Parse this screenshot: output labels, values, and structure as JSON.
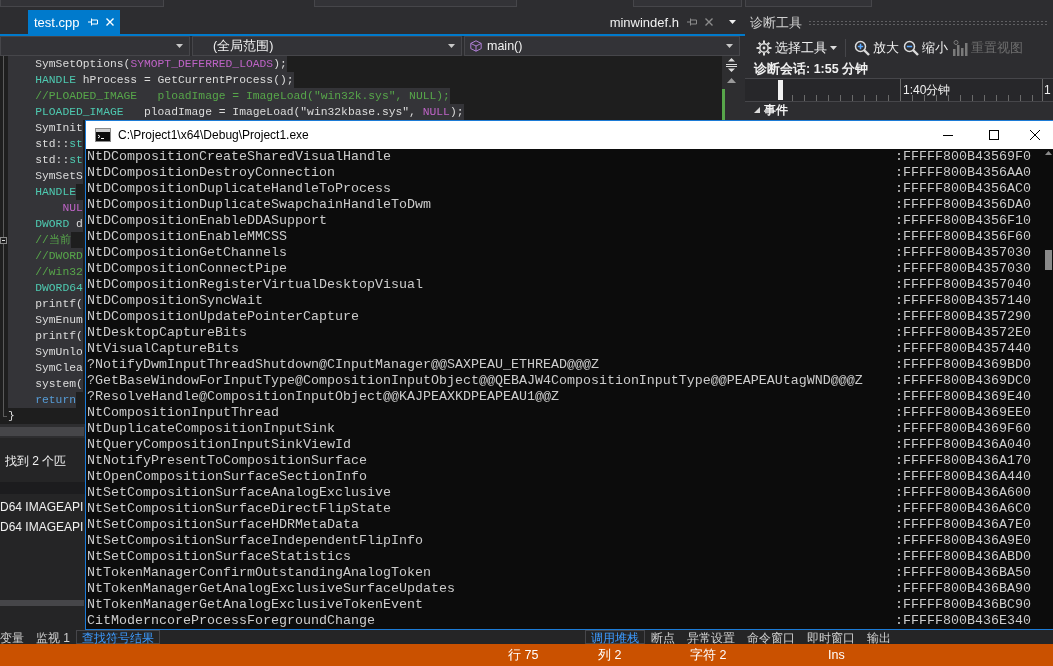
{
  "document_tabs": [
    {
      "label": "test.cpp",
      "kind": "document",
      "selected": true
    },
    {
      "label": "minwindef.h",
      "kind": "preview",
      "selected": false
    }
  ],
  "navigation_bar": {
    "scope": "(全局范围)",
    "member": "main()"
  },
  "editor": {
    "lines": [
      {
        "kind": "code",
        "selected": true,
        "tokens": [
          {
            "kind": "plain",
            "text": "    SymSetOptions("
          },
          {
            "kind": "macro",
            "text": "SYMOPT_DEFERRED_LOADS"
          },
          {
            "kind": "plain",
            "text": ");"
          }
        ]
      },
      {
        "kind": "code",
        "selected": true,
        "tokens": [
          {
            "kind": "type",
            "text": "    HANDLE"
          },
          {
            "kind": "plain",
            "text": " hProcess = GetCurrentProcess();"
          }
        ]
      },
      {
        "kind": "code",
        "selected": true,
        "tokens": [
          {
            "kind": "comment",
            "text": "    //PLOADED_IMAGE   ploadImage = ImageLoad(\"win32k.sys\", NULL);"
          }
        ]
      },
      {
        "kind": "code",
        "selected": true,
        "tokens": [
          {
            "kind": "type",
            "text": "    PLOADED_IMAGE"
          },
          {
            "kind": "plain",
            "text": "   ploadImage = ImageLoad(\"win32kbase.sys\", "
          },
          {
            "kind": "macro",
            "text": "NULL"
          },
          {
            "kind": "plain",
            "text": ");"
          }
        ]
      },
      {
        "kind": "code",
        "selected": true,
        "tokens": [
          {
            "kind": "plain",
            "text": "    SymInit"
          }
        ]
      },
      {
        "kind": "code",
        "selected": true,
        "tokens": [
          {
            "kind": "plain",
            "text": "    std::"
          },
          {
            "kind": "type",
            "text": "st"
          }
        ]
      },
      {
        "kind": "code",
        "selected": true,
        "tokens": [
          {
            "kind": "plain",
            "text": "    std::"
          },
          {
            "kind": "type",
            "text": "st"
          }
        ]
      },
      {
        "kind": "code",
        "selected": true,
        "tokens": [
          {
            "kind": "plain",
            "text": "    SymSetS"
          }
        ]
      },
      {
        "kind": "code",
        "selected": true,
        "tokens": [
          {
            "kind": "type",
            "text": "    HANDLE"
          }
        ]
      },
      {
        "kind": "code",
        "selected": true,
        "tokens": [
          {
            "kind": "macro",
            "text": "        NUL"
          }
        ]
      },
      {
        "kind": "code",
        "selected": true,
        "tokens": [
          {
            "kind": "type",
            "text": "    DWORD"
          },
          {
            "kind": "plain",
            "text": " d"
          }
        ]
      },
      {
        "kind": "fold",
        "selected": true,
        "tokens": [
          {
            "kind": "comment",
            "text": "    //当前"
          }
        ]
      },
      {
        "kind": "code",
        "selected": true,
        "tokens": [
          {
            "kind": "comment",
            "text": "    //DWORD"
          }
        ]
      },
      {
        "kind": "code",
        "selected": true,
        "tokens": [
          {
            "kind": "comment",
            "text": "    //win32"
          }
        ]
      },
      {
        "kind": "code",
        "selected": true,
        "tokens": [
          {
            "kind": "type",
            "text": "    DWORD64"
          }
        ]
      },
      {
        "kind": "code",
        "selected": true,
        "tokens": [
          {
            "kind": "plain",
            "text": "    printf("
          }
        ]
      },
      {
        "kind": "code",
        "selected": true,
        "tokens": [
          {
            "kind": "plain",
            "text": "    SymEnum"
          }
        ]
      },
      {
        "kind": "code",
        "selected": true,
        "tokens": [
          {
            "kind": "plain",
            "text": "    printf("
          }
        ]
      },
      {
        "kind": "code",
        "selected": true,
        "tokens": [
          {
            "kind": "plain",
            "text": "    SymUnlo"
          }
        ]
      },
      {
        "kind": "code",
        "selected": true,
        "tokens": [
          {
            "kind": "plain",
            "text": "    SymClea"
          }
        ]
      },
      {
        "kind": "code",
        "selected": true,
        "tokens": [
          {
            "kind": "plain",
            "text": "    system("
          }
        ]
      },
      {
        "kind": "code",
        "selected": true,
        "tokens": [
          {
            "kind": "keyword",
            "text": "    return"
          }
        ]
      },
      {
        "kind": "end",
        "selected": false,
        "tokens": [
          {
            "kind": "plain",
            "text": "}"
          }
        ]
      }
    ]
  },
  "diagnostic_tools": {
    "title": "诊断工具",
    "toolbar": [
      {
        "kind": "dropdown",
        "label": "选择工具",
        "disabled": false
      },
      {
        "kind": "button",
        "label": "放大",
        "disabled": false
      },
      {
        "kind": "button",
        "label": "缩小",
        "disabled": false
      },
      {
        "kind": "button",
        "label": "重置视图",
        "disabled": true
      }
    ],
    "session": "诊断会话: 1:55 分钟",
    "timeline_labels": [
      "1:40分钟",
      "1"
    ],
    "events": {
      "label": "事件",
      "expanded": true
    }
  },
  "console": {
    "title": "C:\\Project1\\x64\\Debug\\Project1.exe",
    "rows": [
      {
        "name": "NtDCompositionCreateSharedVisualHandle",
        "address": ":FFFFF800B43569F0"
      },
      {
        "name": "NtDCompositionDestroyConnection",
        "address": ":FFFFF800B4356AA0"
      },
      {
        "name": "NtDCompositionDuplicateHandleToProcess",
        "address": ":FFFFF800B4356AC0"
      },
      {
        "name": "NtDCompositionDuplicateSwapchainHandleToDwm",
        "address": ":FFFFF800B4356DA0"
      },
      {
        "name": "NtDCompositionEnableDDASupport",
        "address": ":FFFFF800B4356F10"
      },
      {
        "name": "NtDCompositionEnableMMCSS",
        "address": ":FFFFF800B4356F60"
      },
      {
        "name": "NtDCompositionGetChannels",
        "address": ":FFFFF800B4357030"
      },
      {
        "name": "NtDCompositionConnectPipe",
        "address": ":FFFFF800B4357030"
      },
      {
        "name": "NtDCompositionRegisterVirtualDesktopVisual",
        "address": ":FFFFF800B4357040"
      },
      {
        "name": "NtDCompositionSyncWait",
        "address": ":FFFFF800B4357140"
      },
      {
        "name": "NtDCompositionUpdatePointerCapture",
        "address": ":FFFFF800B4357290"
      },
      {
        "name": "NtDesktopCaptureBits",
        "address": ":FFFFF800B43572E0"
      },
      {
        "name": "NtVisualCaptureBits",
        "address": ":FFFFF800B4357440"
      },
      {
        "name": "?NotifyDwmInputThreadShutdown@CInputManager@@SAXPEAU_ETHREAD@@@Z",
        "address": ":FFFFF800B4369BD0"
      },
      {
        "name": "?GetBaseWindowForInputType@CompositionInputObject@@QEBAJW4CompositionInputType@@PEAPEAUtagWND@@@Z",
        "address": ":FFFFF800B4369DC0"
      },
      {
        "name": "?ResolveHandle@CompositionInputObject@@KAJPEAXKDPEAPEAU1@@Z",
        "address": ":FFFFF800B4369E40"
      },
      {
        "name": "NtCompositionInputThread",
        "address": ":FFFFF800B4369EE0"
      },
      {
        "name": "NtDuplicateCompositionInputSink",
        "address": ":FFFFF800B4369F60"
      },
      {
        "name": "NtQueryCompositionInputSinkViewId",
        "address": ":FFFFF800B436A040"
      },
      {
        "name": "NtNotifyPresentToCompositionSurface",
        "address": ":FFFFF800B436A170"
      },
      {
        "name": "NtOpenCompositionSurfaceSectionInfo",
        "address": ":FFFFF800B436A440"
      },
      {
        "name": "NtSetCompositionSurfaceAnalogExclusive",
        "address": ":FFFFF800B436A600"
      },
      {
        "name": "NtSetCompositionSurfaceDirectFlipState",
        "address": ":FFFFF800B436A6C0"
      },
      {
        "name": "NtSetCompositionSurfaceHDRMetaData",
        "address": ":FFFFF800B436A7E0"
      },
      {
        "name": "NtSetCompositionSurfaceIndependentFlipInfo",
        "address": ":FFFFF800B436A9E0"
      },
      {
        "name": "NtSetCompositionSurfaceStatistics",
        "address": ":FFFFF800B436ABD0"
      },
      {
        "name": "NtTokenManagerConfirmOutstandingAnalogToken",
        "address": ":FFFFF800B436BA50"
      },
      {
        "name": "NtTokenManagerGetAnalogExclusiveSurfaceUpdates",
        "address": ":FFFFF800B436BA90"
      },
      {
        "name": "NtTokenManagerGetAnalogExclusiveTokenEvent",
        "address": ":FFFFF800B436BC90"
      },
      {
        "name": "CitModerncoreProcessForegroundChange",
        "address": ":FFFFF800B436E340"
      }
    ]
  },
  "find_results": {
    "summary": "找到 2 个匹",
    "rows": [
      "D64 IMAGEAPI",
      "D64 IMAGEAPI"
    ]
  },
  "bottom_left_tabs": [
    {
      "label": "变量",
      "selected": false
    },
    {
      "label": "监视 1",
      "selected": false
    },
    {
      "label": "查找符号结果",
      "selected": true
    }
  ],
  "bottom_right_tabs": [
    {
      "label": "调用堆栈",
      "selected": true
    },
    {
      "label": "断点",
      "selected": false
    },
    {
      "label": "异常设置",
      "selected": false
    },
    {
      "label": "命令窗口",
      "selected": false
    },
    {
      "label": "即时窗口",
      "selected": false
    },
    {
      "label": "输出",
      "selected": false
    }
  ],
  "status_bar": {
    "line": "行 75",
    "column": "列 2",
    "character": "字符 2",
    "mode": "Ins"
  }
}
